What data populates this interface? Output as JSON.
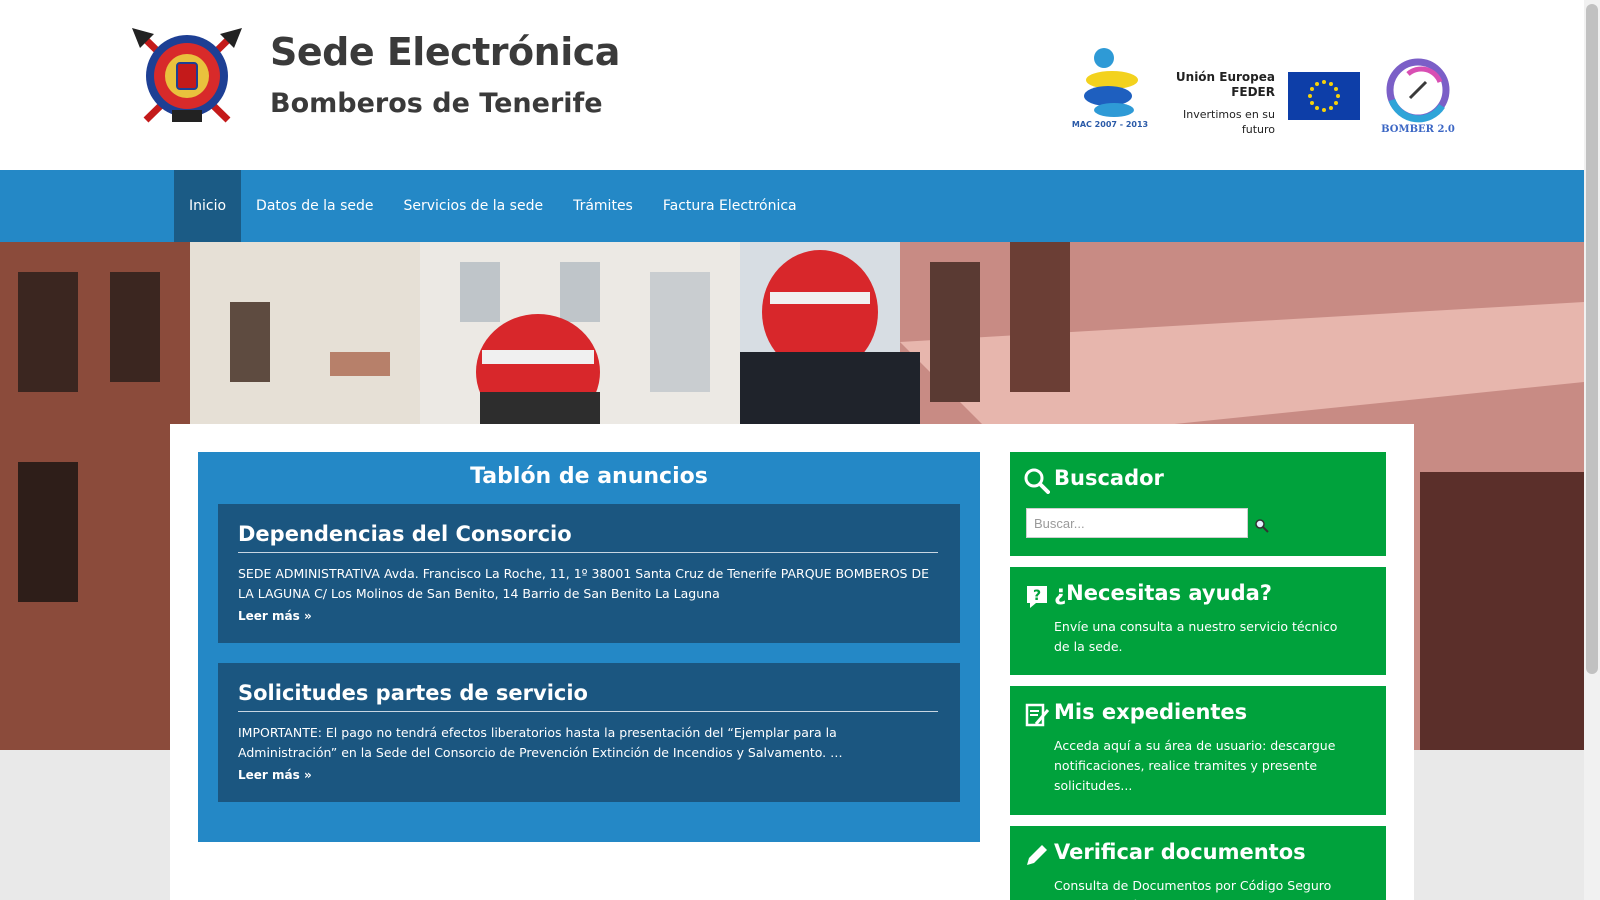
{
  "header": {
    "title": "Sede Electrónica",
    "subtitle": "Bomberos de Tenerife",
    "mac_caption": "MAC 2007 - 2013",
    "feder_line1": "Unión Europea",
    "feder_line2": "FEDER",
    "feder_slogan": "Invertimos en su futuro",
    "bomber_caption": "BOMBER 2.0"
  },
  "nav": {
    "items": [
      {
        "label": "Inicio",
        "active": true
      },
      {
        "label": "Datos de la sede"
      },
      {
        "label": "Servicios de la sede"
      },
      {
        "label": "Trámites"
      },
      {
        "label": "Factura Electrónica"
      }
    ]
  },
  "board": {
    "title": "Tablón de anuncios",
    "notices": [
      {
        "title": "Dependencias del Consorcio",
        "body": "SEDE ADMINISTRATIVA Avda. Francisco La Roche, 11, 1º 38001 Santa Cruz de Tenerife PARQUE BOMBEROS DE LA LAGUNA C/ Los Molinos de San Benito, 14  Barrio de San Benito La Laguna",
        "more": "Leer más »"
      },
      {
        "title": "Solicitudes partes de servicio",
        "body": "IMPORTANTE:  El pago no tendrá efectos liberatorios hasta la presentación del “Ejemplar para la Administración” en la Sede del Consorcio de Prevención Extinción de Incendios y Salvamento. …",
        "more": "Leer más »"
      }
    ]
  },
  "sidebar": {
    "search": {
      "title": "Buscador",
      "placeholder": "Buscar..."
    },
    "help": {
      "title": "¿Necesitas ayuda?",
      "text": "Envíe una consulta a nuestro servicio técnico de la sede."
    },
    "files": {
      "title": "Mis expedientes",
      "text": "Acceda aquí a su área de usuario: descargue notificaciones, realice tramites y presente solicitudes..."
    },
    "verify": {
      "title": "Verificar documentos",
      "text": "Consulta de Documentos por Código Seguro de Verificación (CSV)"
    }
  },
  "colors": {
    "nav_blue": "#2488c6",
    "nav_active": "#1b5b85",
    "notice_bg": "#1b5680",
    "widget_green": "#00a23c"
  }
}
